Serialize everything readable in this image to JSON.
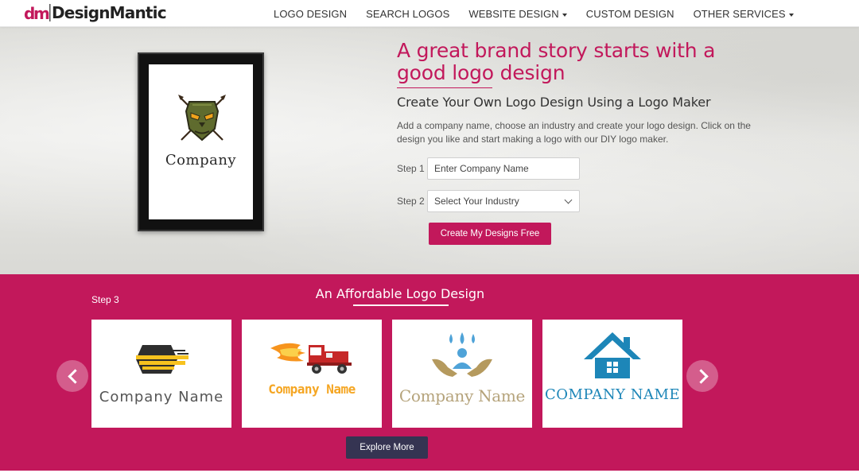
{
  "brand": {
    "name": "DesignMantic"
  },
  "nav": [
    {
      "label": "LOGO DESIGN",
      "dropdown": false
    },
    {
      "label": "SEARCH LOGOS",
      "dropdown": false
    },
    {
      "label": "WEBSITE DESIGN",
      "dropdown": true
    },
    {
      "label": "CUSTOM DESIGN",
      "dropdown": false
    },
    {
      "label": "OTHER SERVICES",
      "dropdown": true
    }
  ],
  "hero": {
    "title": "A great brand story starts with a good logo design",
    "subtitle": "Create Your Own Logo Design Using a Logo Maker",
    "description": "Add a company name, choose an industry and create your logo design. Click on the design you like and start making a logo with our DIY logo maker.",
    "frame_company": "Company",
    "step1_label": "Step 1",
    "company_placeholder": "Enter Company Name",
    "step2_label": "Step 2",
    "industry_selected": "Select Your Industry",
    "create_button": "Create My Designs Free"
  },
  "gallery": {
    "step3_label": "Step 3",
    "title": "An Affordable Logo Design",
    "cards": [
      {
        "label": "Company Name",
        "icon": "hexagon-speed-icon",
        "color": "#555555"
      },
      {
        "label": "Company Name",
        "icon": "fire-truck-icon",
        "color": "#f5a623"
      },
      {
        "label": "Company Name",
        "icon": "hands-water-drops-icon",
        "color": "#b59a5e"
      },
      {
        "label": "COMPANY NAME",
        "icon": "house-icon",
        "color": "#1d86b8"
      }
    ],
    "explore_button": "Explore More"
  },
  "colors": {
    "accent": "#c2185b",
    "explore": "#353452"
  }
}
